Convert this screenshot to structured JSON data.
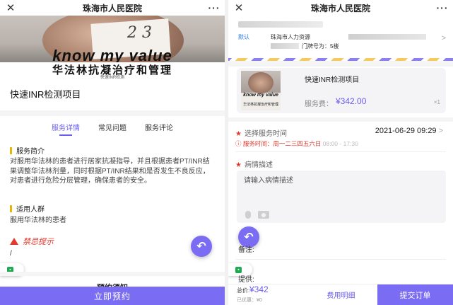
{
  "colors": {
    "accent": "#7b6cf4",
    "warning": "#e23a2f",
    "link": "#2d7bd6",
    "section_bar": "#e6b800"
  },
  "left": {
    "nav": {
      "close": "✕",
      "title": "珠海市人民医院",
      "more": "···"
    },
    "hero": {
      "text_en": "know my value",
      "scribble": "2 3",
      "title_cn": "华法林抗凝治疗和管理",
      "subtitle_cn": "快速INR检测"
    },
    "product_title": "快速INR检测项目",
    "tabs": [
      "服务详情",
      "常见问题",
      "服务评论"
    ],
    "sections": {
      "intro_title": "服务简介",
      "intro_body": "对服用华法林的患者进行居家抗凝指导，并且根据患者PT/INR结果调整华法林剂量，同时根据PT/INR结果和是否发生不良反应，对患者进行危险分层管理，确保患者的安全。",
      "audience_title": "适用人群",
      "audience_body": "服用华法林的患者",
      "warning_title": "禁忌提示",
      "warning_body": "/",
      "notice_title": "预约须知"
    },
    "book_button": "立即预约"
  },
  "right": {
    "nav": {
      "close": "✕",
      "title": "珠海市人民医院",
      "more": "···"
    },
    "address": {
      "default_tag": "默认",
      "line1": "珠海市人力资源",
      "line2": "门牌号为：5楼",
      "arrow": ">"
    },
    "item": {
      "image_text_en": "know my value",
      "image_text_cn": "华法林抗凝治疗和管理",
      "name": "快速INR检测项目",
      "fee_label": "服务费：",
      "fee": "¥342.00",
      "qty": "×1"
    },
    "service_time": {
      "label": "选择服务时间",
      "value": "2021-06-29 09:29",
      "chevron": ">",
      "hours_label": "服务时间：周一二三四五六日",
      "hours": "08:00 - 17:30"
    },
    "description": {
      "label": "病情描述",
      "placeholder": "请输入病情描述"
    },
    "remark_label": "备注:",
    "provide_label": "提供:",
    "bottom": {
      "total_label": "总价:",
      "total": "¥342",
      "discount": "已优惠：¥0",
      "detail": "费用明细",
      "submit": "提交订单"
    }
  }
}
